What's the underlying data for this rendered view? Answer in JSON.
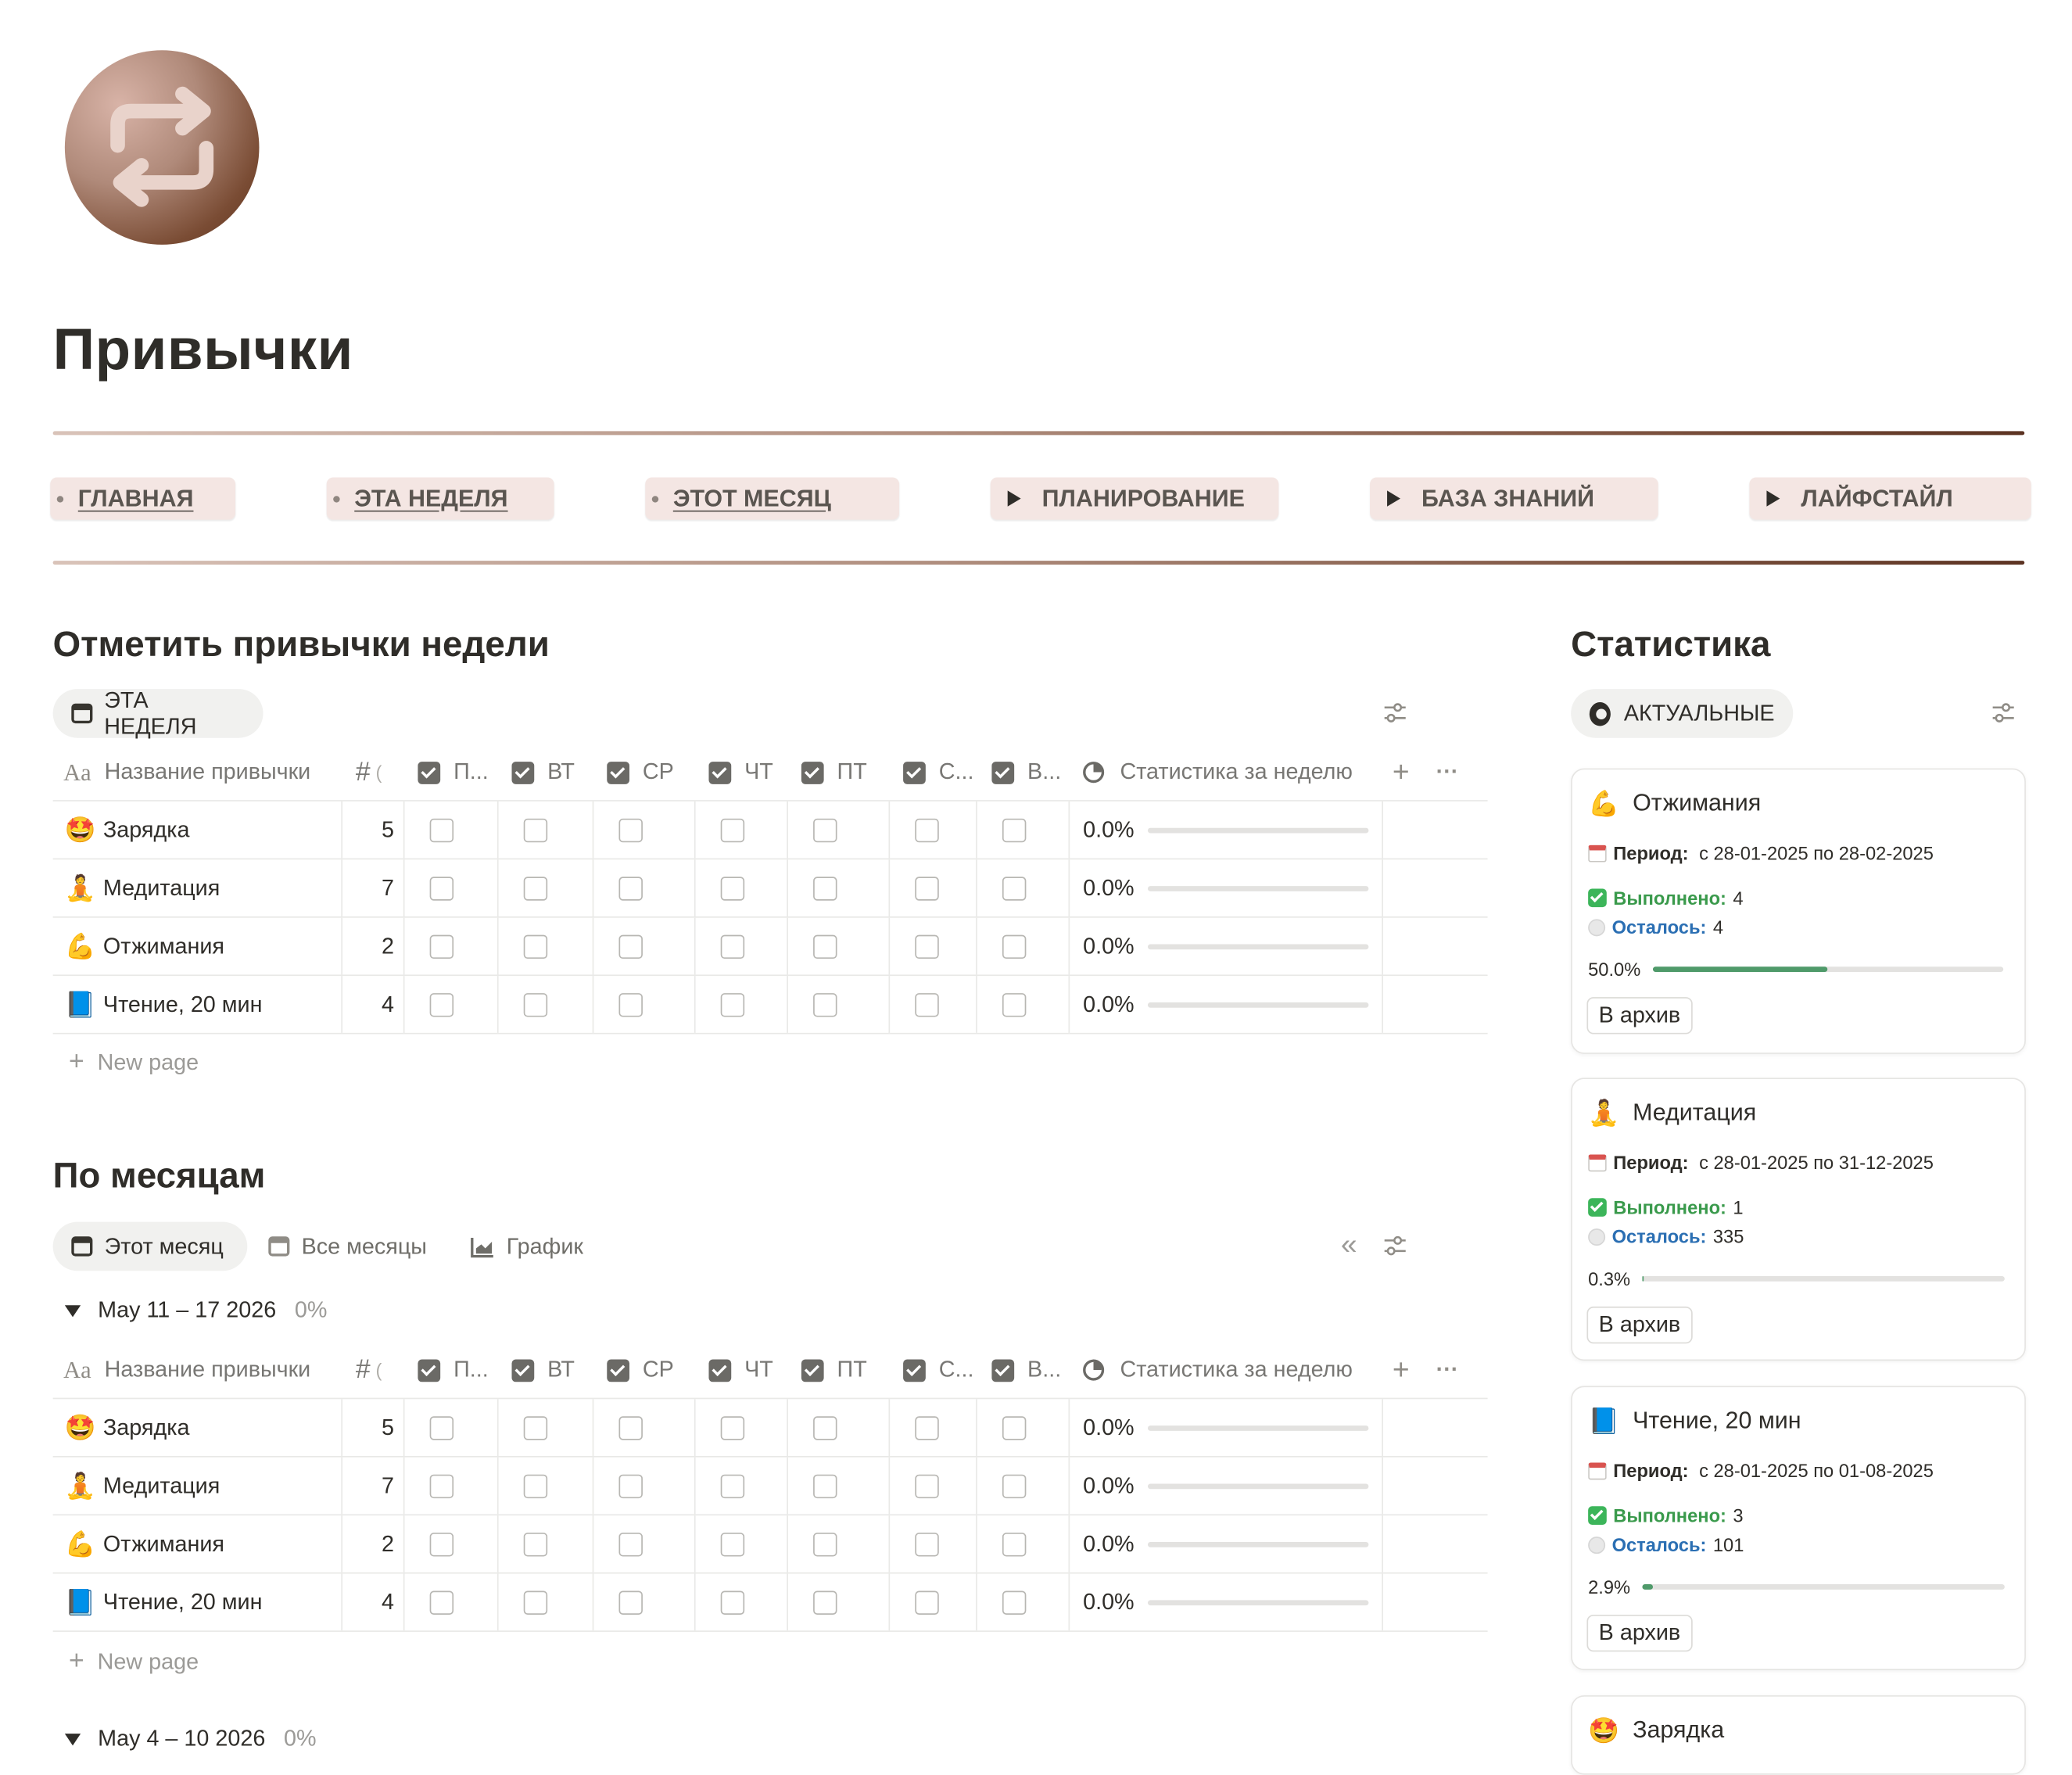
{
  "page": {
    "title": "Привычки"
  },
  "nav": [
    {
      "label": "ГЛАВНАЯ",
      "kind": "link"
    },
    {
      "label": "ЭТА НЕДЕЛЯ",
      "kind": "link"
    },
    {
      "label": "ЭТОТ МЕСЯЦ",
      "kind": "link"
    },
    {
      "label": "ПЛАНИРОВАНИЕ",
      "kind": "toggle"
    },
    {
      "label": "БАЗА ЗНАНИЙ",
      "kind": "toggle"
    },
    {
      "label": "ЛАЙФСТАЙЛ",
      "kind": "toggle"
    }
  ],
  "weekly": {
    "title": "Отметить привычки недели",
    "view_label": "ЭТА НЕДЕЛЯ",
    "columns": {
      "name": "Название привычки",
      "num": "#",
      "cut": "(",
      "days": [
        "П...",
        "ВТ",
        "СР",
        "ЧТ",
        "ПТ",
        "С...",
        "В..."
      ],
      "stats": "Статистика за неделю"
    },
    "rows": [
      {
        "icon": "star-struck-emoji",
        "emoji": "🤩",
        "name": "Зарядка",
        "num": "5",
        "stat": "0.0%"
      },
      {
        "icon": "meditation-emoji",
        "emoji": "🧘",
        "name": "Медитация",
        "num": "7",
        "stat": "0.0%"
      },
      {
        "icon": "flexed-biceps-emoji",
        "emoji": "💪",
        "name": "Отжимания",
        "num": "2",
        "stat": "0.0%"
      },
      {
        "icon": "blue-book-emoji",
        "emoji": "📘",
        "name": "Чтение, 20 мин",
        "num": "4",
        "stat": "0.0%"
      }
    ],
    "new_page": "New page"
  },
  "monthly": {
    "title": "По месяцам",
    "tabs": [
      "Этот месяц",
      "Все месяцы",
      "График"
    ],
    "group1": {
      "label": "May 11 – 17 2026",
      "pct": "0%"
    },
    "group2": {
      "label": "May 4 – 10 2026",
      "pct": "0%"
    },
    "new_page": "New page"
  },
  "stats": {
    "title": "Статистика",
    "view_label": "АКТУАЛЬНЫЕ",
    "period_label": "Период:",
    "done_label": "Выполнено:",
    "left_label": "Осталось:",
    "archive_label": "В архив",
    "cards": [
      {
        "emoji": "💪",
        "icon": "flexed-biceps-emoji",
        "name": "Отжимания",
        "period": "с 28-01-2025 по 28-02-2025",
        "done": "4",
        "left": "4",
        "pct_text": "50.0%",
        "progress": 0.5
      },
      {
        "emoji": "🧘",
        "icon": "meditation-emoji",
        "name": "Медитация",
        "period": "с 28-01-2025 по 31-12-2025",
        "done": "1",
        "left": "335",
        "pct_text": "0.3%",
        "progress": 0.003
      },
      {
        "emoji": "📘",
        "icon": "blue-book-emoji",
        "name": "Чтение, 20 мин",
        "period": "с 28-01-2025 по 01-08-2025",
        "done": "3",
        "left": "101",
        "pct_text": "2.9%",
        "progress": 0.029
      },
      {
        "emoji": "🤩",
        "icon": "star-struck-emoji",
        "name": "Зарядка"
      }
    ]
  },
  "colors": {
    "accent_brown": "#7d5340",
    "nav_bg": "#f4e6e3",
    "progress_green": "#4f9a6a",
    "done_green": "#3a9a4c",
    "left_blue": "#2b6fb3"
  }
}
